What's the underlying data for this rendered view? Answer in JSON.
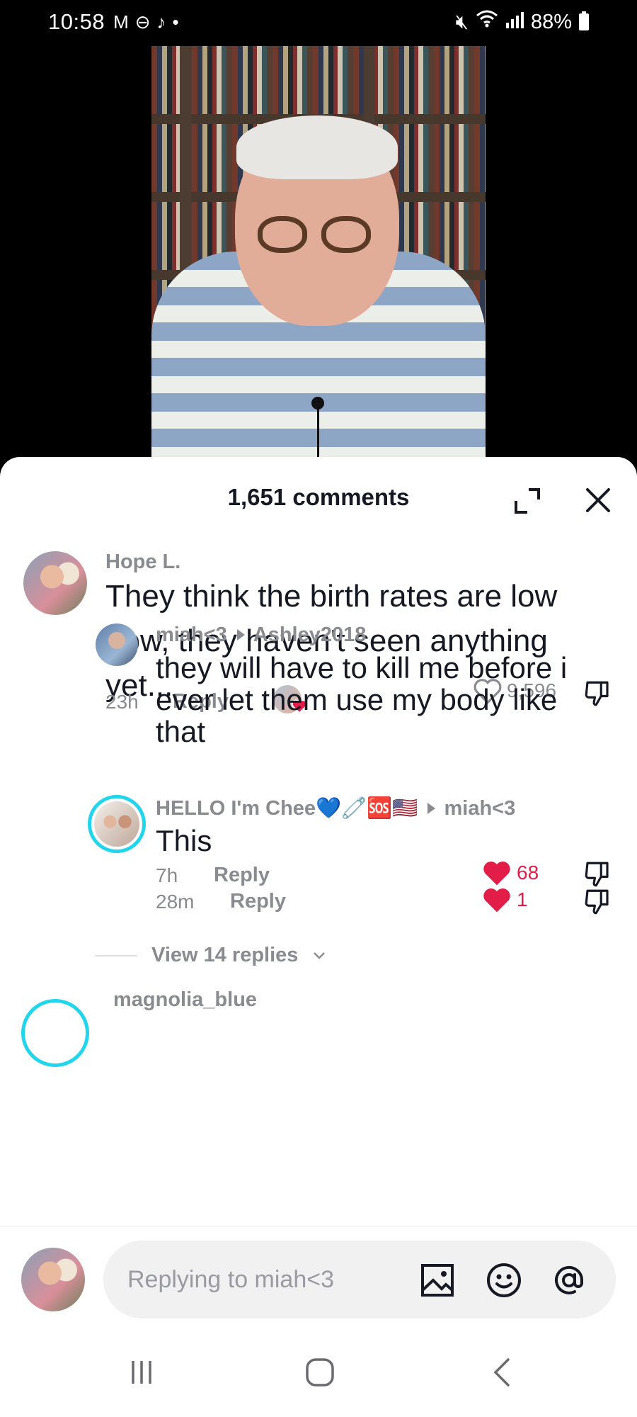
{
  "status_bar": {
    "time": "10:58",
    "battery": "88%",
    "icons_left": [
      "gmail-icon",
      "dnd-icon",
      "tiktok-icon",
      "dot-icon"
    ],
    "icons_right": [
      "mute-icon",
      "wifi-icon",
      "signal-icon",
      "battery-icon"
    ]
  },
  "sheet": {
    "title": "1,651 comments"
  },
  "comments": [
    {
      "user": "Hope L.",
      "text": "They think the birth rates are low now, they haven't seen anything yet...",
      "time": "23h",
      "reply_label": "Reply",
      "likes": "9,596",
      "liked": false
    },
    {
      "user": "miah<3",
      "reply_to": "Ashley2018",
      "text": "they will have to kill me before i ever let them use my body like that",
      "time": "7h",
      "reply_label": "Reply",
      "likes": "68",
      "liked": true
    },
    {
      "user": "HELLO I'm Chee",
      "user_emoji": "💙🧷🆘🇺🇸",
      "reply_to": "miah<3",
      "text": "This",
      "time": "28m",
      "reply_label": "Reply",
      "likes": "1",
      "liked": true
    }
  ],
  "view_replies": "View 14 replies",
  "next_comment_user": "magnolia_blue",
  "input": {
    "placeholder": "Replying to miah<3"
  },
  "colors": {
    "like_red": "#e11d48",
    "meta_gray": "#8a8b91",
    "text_dark": "#161823",
    "input_bg": "#f1f1f2"
  }
}
